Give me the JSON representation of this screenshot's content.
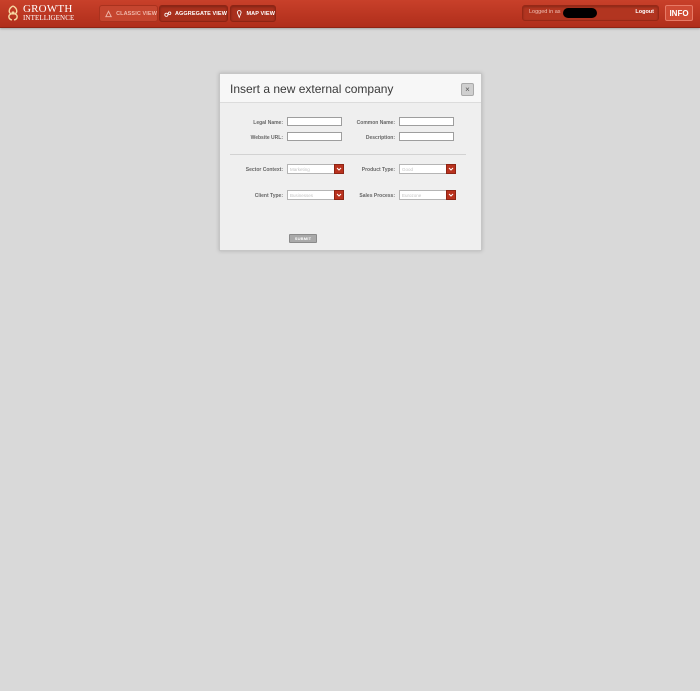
{
  "header": {
    "logo_line1": "GROWTH",
    "logo_line2": "INTELLIGENCE",
    "nav": {
      "classic": "CLASSIC VIEW",
      "aggregate": "AGGREGATE VIEW",
      "map": "MAP VIEW"
    },
    "logged_in_label": "Logged in as",
    "logout": "Logout",
    "info": "INFO"
  },
  "dialog": {
    "title": "Insert a new external company",
    "close": "×",
    "fields": {
      "legal_name": {
        "label": "Legal Name:",
        "value": ""
      },
      "common_name": {
        "label": "Common Name:",
        "value": ""
      },
      "website_url": {
        "label": "Website URL:",
        "value": ""
      },
      "description": {
        "label": "Description:",
        "value": ""
      }
    },
    "selects": {
      "sector_context": {
        "label": "Sector Context:",
        "value": "Marketing"
      },
      "product_type": {
        "label": "Product Type:",
        "value": "Good"
      },
      "client_type": {
        "label": "Client Type:",
        "value": "Businesses"
      },
      "sales_process": {
        "label": "Sales Process:",
        "value": "Eurozone"
      }
    },
    "submit": "SUBMIT"
  },
  "colors": {
    "brand_red": "#b8331f",
    "background": "#d9d9d9"
  },
  "icons": {
    "logo": "growth-mark-icon",
    "classic": "classic-view-icon",
    "aggregate": "aggregate-view-icon",
    "map": "map-pin-icon",
    "select_arrow": "chevron-down-icon",
    "close": "close-icon"
  }
}
